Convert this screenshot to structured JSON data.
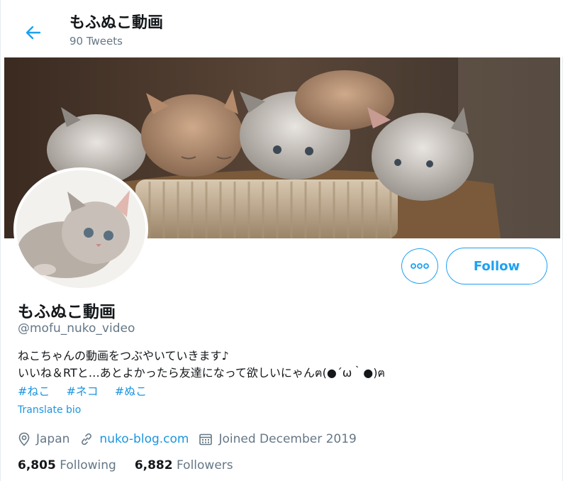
{
  "header": {
    "title": "もふぬこ動画",
    "tweet_count": "90 Tweets"
  },
  "profile": {
    "name": "もふぬこ動画",
    "handle": "@mofu_nuko_video",
    "bio_line1": "ねこちゃんの動画をつぶやいていきます♪",
    "bio_line2": "いいね＆RTと…あとよかったら友達になって欲しいにゃんฅ(●´ω｀●)ฅ",
    "hashtags": [
      "#ねこ",
      "#ネコ",
      "#ぬこ"
    ],
    "translate_label": "Translate bio",
    "location": "Japan",
    "website": "nuko-blog.com",
    "joined": "Joined December 2019",
    "following_count": "6,805",
    "following_label": "Following",
    "followers_count": "6,882",
    "followers_label": "Followers"
  },
  "actions": {
    "follow_label": "Follow",
    "more_icon": "more-dots-icon"
  },
  "colors": {
    "accent": "#1da1f2",
    "link": "#1b95e0",
    "secondary_text": "#657786",
    "primary_text": "#14171a"
  }
}
